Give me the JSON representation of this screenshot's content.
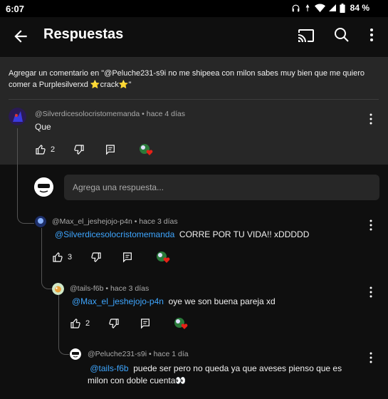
{
  "status": {
    "time": "6:07",
    "battery": "84 %"
  },
  "header": {
    "title": "Respuestas",
    "icons": [
      "back-arrow-icon",
      "cast-icon",
      "search-icon",
      "more-vert-icon"
    ]
  },
  "context": {
    "text": "Agregar un comentario en \"@Peluche231-s9i no me shipeea con milon sabes muy bien que me quiero comer a Purplesilverxd ⭐crack⭐\""
  },
  "comments": [
    {
      "author": "@Silverdicesolocristomemanda",
      "time": "hace 4 días",
      "mention": "",
      "text": "Que",
      "likes": "2"
    },
    {
      "author": "@Max_el_jeshejojo-p4n",
      "time": "hace 3 días",
      "mention": "@Silverdicesolocristomemanda",
      "text": "CORRE POR TU VIDA!! xDDDDD",
      "likes": "3"
    },
    {
      "author": "@tails-f6b",
      "time": "hace 3 días",
      "mention": "@Max_el_jeshejojo-p4n",
      "text": "oye we son buena pareja xd",
      "likes": "2"
    },
    {
      "author": "@Peluche231-s9i",
      "time": "hace 1 día",
      "mention": "@tails-f6b",
      "text": "puede ser pero no queda ya que aveses pienso que es milon con doble cuenta👀",
      "likes": ""
    }
  ],
  "reply_input": {
    "placeholder": "Agrega una respuesta..."
  },
  "colors": {
    "background": "#0f0f0f",
    "context_bg": "#272727",
    "mention": "#3ea6ff",
    "heart": "#e62117"
  }
}
